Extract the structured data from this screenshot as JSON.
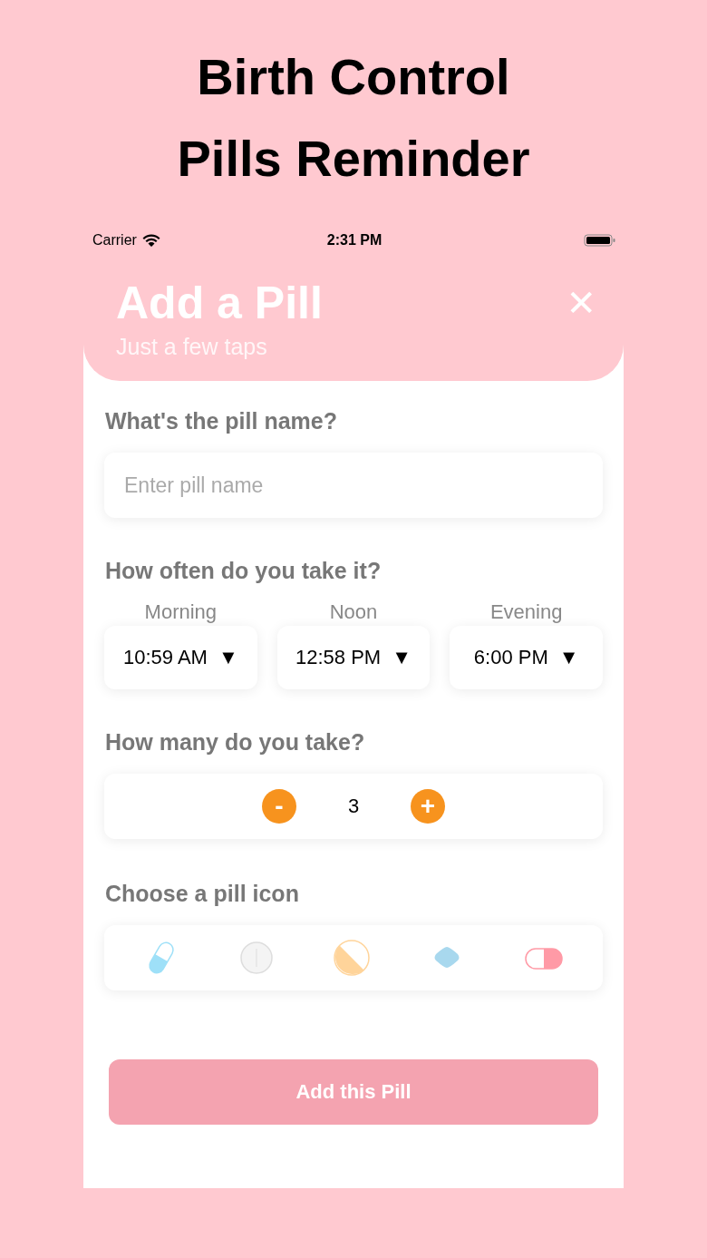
{
  "headline": [
    "Birth Control",
    "Pills Reminder"
  ],
  "status_bar": {
    "carrier": "Carrier",
    "time": "2:31 PM"
  },
  "header": {
    "title": "Add a Pill",
    "subtitle": "Just a few taps",
    "close": "✕"
  },
  "name_section": {
    "label": "What's the pill name?",
    "placeholder": "Enter pill name"
  },
  "schedule_section": {
    "label": "How often do you take it?",
    "times": [
      {
        "label": "Morning",
        "value": "10:59 AM",
        "caret": "▼"
      },
      {
        "label": "Noon",
        "value": "12:58 PM",
        "caret": "▼"
      },
      {
        "label": "Evening",
        "value": "6:00 PM",
        "caret": "▼"
      }
    ]
  },
  "quantity_section": {
    "label": "How many do you take?",
    "minus": "-",
    "count": "3",
    "plus": "+"
  },
  "icon_section": {
    "label": "Choose a pill icon",
    "icons": [
      {
        "kind": "capsule"
      },
      {
        "kind": "round"
      },
      {
        "kind": "split"
      },
      {
        "kind": "diamond"
      },
      {
        "kind": "oval"
      }
    ]
  },
  "submit": "Add this Pill"
}
